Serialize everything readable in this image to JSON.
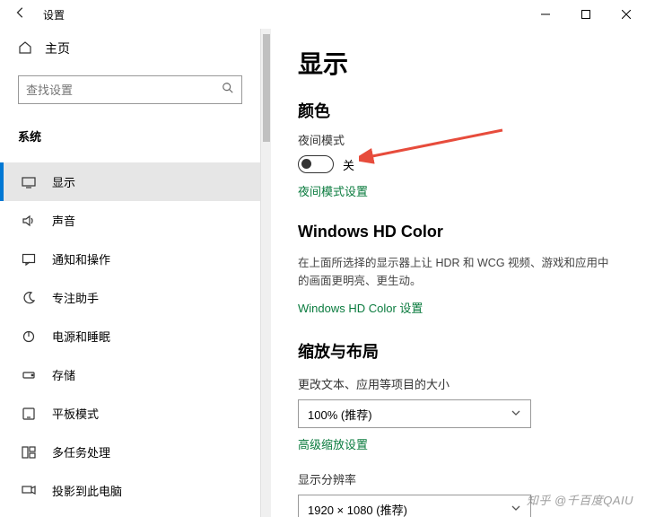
{
  "titlebar": {
    "back_icon": "back",
    "title": "设置"
  },
  "sidebar": {
    "home_label": "主页",
    "search_placeholder": "查找设置",
    "category_label": "系统",
    "items": [
      {
        "label": "显示"
      },
      {
        "label": "声音"
      },
      {
        "label": "通知和操作"
      },
      {
        "label": "专注助手"
      },
      {
        "label": "电源和睡眠"
      },
      {
        "label": "存储"
      },
      {
        "label": "平板模式"
      },
      {
        "label": "多任务处理"
      },
      {
        "label": "投影到此电脑"
      }
    ]
  },
  "content": {
    "page_title": "显示",
    "color_section": "颜色",
    "night_light_label": "夜间模式",
    "night_light_state": "关",
    "night_light_link": "夜间模式设置",
    "hd_color_title": "Windows HD Color",
    "hd_color_desc": "在上面所选择的显示器上让 HDR 和 WCG 视频、游戏和应用中的画面更明亮、更生动。",
    "hd_color_link": "Windows HD Color 设置",
    "scale_title": "缩放与布局",
    "scale_label": "更改文本、应用等项目的大小",
    "scale_value": "100% (推荐)",
    "scale_link": "高级缩放设置",
    "resolution_label": "显示分辨率",
    "resolution_value": "1920 × 1080 (推荐)"
  },
  "watermark": "知乎 @千百度QAIU"
}
